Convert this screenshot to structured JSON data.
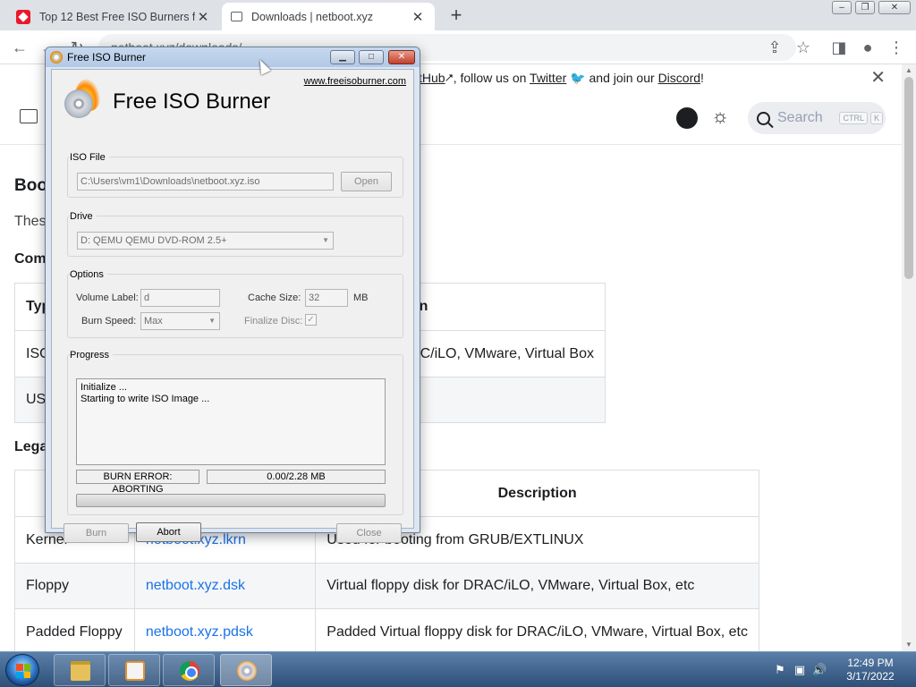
{
  "browser": {
    "tabs": [
      {
        "title": "Top 12 Best Free ISO Burners for"
      },
      {
        "title": "Downloads | netboot.xyz"
      }
    ],
    "url": "netboot.xyz/downloads/"
  },
  "webpage": {
    "banner": {
      "prefix": "tHub",
      "text_mid": ", follow us on ",
      "twitter": "Twitter",
      "text_join": " and join our ",
      "discord": "Discord",
      "suffix": "!"
    },
    "search": {
      "label": "Search",
      "kbd1": "CTRL",
      "kbd2": "K"
    },
    "fragments": {
      "heading1": "Boo",
      "para1": "Thes",
      "heading2": "Com",
      "heading3": "Lega"
    },
    "table1": {
      "header_first": "Typ",
      "header_last": "on",
      "rows": [
        {
          "first": "ISO",
          "last": "AC/iLO, VMware, Virtual Box"
        },
        {
          "first": "US",
          "last": ""
        }
      ]
    },
    "table2": {
      "header_desc": "Description",
      "rows": [
        {
          "type": "Kernel",
          "file": "netboot.xyz.lkrn",
          "desc": "Used for booting from GRUB/EXTLINUX"
        },
        {
          "type": "Floppy",
          "file": "netboot.xyz.dsk",
          "desc": "Virtual floppy disk for DRAC/iLO, VMware, Virtual Box, etc"
        },
        {
          "type": "Padded Floppy",
          "file": "netboot.xyz.pdsk",
          "desc": "Padded Virtual floppy disk for DRAC/iLO, VMware, Virtual Box, etc"
        }
      ]
    }
  },
  "dialog": {
    "title": "Free ISO Burner",
    "website": "www.freeisoburner.com",
    "app_title": "Free ISO Burner",
    "iso_group": "ISO File",
    "iso_path": "C:\\Users\\vm1\\Downloads\\netboot.xyz.iso",
    "open_btn": "Open",
    "drive_group": "Drive",
    "drive_value": "D: QEMU     QEMU DVD-ROM     2.5+",
    "options_group": "Options",
    "volume_label_lbl": "Volume Label:",
    "volume_label_val": "d",
    "cache_size_lbl": "Cache Size:",
    "cache_size_val": "32",
    "cache_unit": "MB",
    "burn_speed_lbl": "Burn Speed:",
    "burn_speed_val": "Max",
    "finalize_lbl": "Finalize Disc:",
    "finalize_checked": true,
    "progress_group": "Progress",
    "log_lines": [
      "Initialize ...",
      "Starting to write ISO Image ..."
    ],
    "status": "BURN ERROR: ABORTING",
    "size_progress": "0.00/2.28 MB",
    "progress_fraction": 0,
    "burn_btn": "Burn",
    "abort_btn": "Abort",
    "close_btn": "Close"
  },
  "taskbar": {
    "time": "12:49 PM",
    "date": "3/17/2022"
  }
}
